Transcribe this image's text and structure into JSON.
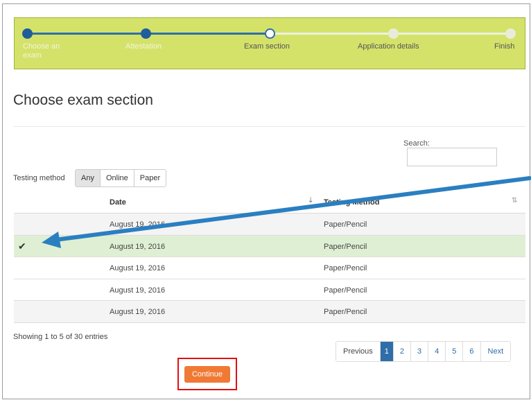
{
  "wizard": {
    "steps": [
      {
        "label": "Choose an exam",
        "state": "done"
      },
      {
        "label": "Attestation",
        "state": "done"
      },
      {
        "label": "Exam section",
        "state": "current"
      },
      {
        "label": "Application details",
        "state": "todo"
      },
      {
        "label": "Finish",
        "state": "todo"
      }
    ]
  },
  "page": {
    "title": "Choose exam section"
  },
  "search": {
    "label": "Search:",
    "value": ""
  },
  "filter": {
    "label": "Testing method",
    "options": [
      "Any",
      "Online",
      "Paper"
    ],
    "selected": "Any"
  },
  "table": {
    "columns": [
      "Date",
      "Testing Method"
    ],
    "rows": [
      {
        "date": "August 19, 2016",
        "method": "Paper/Pencil",
        "selected": false
      },
      {
        "date": "August 19, 2016",
        "method": "Paper/Pencil",
        "selected": true
      },
      {
        "date": "August 19, 2016",
        "method": "Paper/Pencil",
        "selected": false
      },
      {
        "date": "August 19, 2016",
        "method": "Paper/Pencil",
        "selected": false
      },
      {
        "date": "August 19, 2016",
        "method": "Paper/Pencil",
        "selected": false
      }
    ],
    "check_glyph": "✔"
  },
  "info": "Showing 1 to 5 of 30 entries",
  "pagination": {
    "previous": "Previous",
    "pages": [
      "1",
      "2",
      "3",
      "4",
      "5",
      "6"
    ],
    "current": "1",
    "next": "Next"
  },
  "continue_label": "Continue",
  "colors": {
    "wizard_bg": "#d4e26a",
    "accent_blue": "#2f6ea8",
    "button_orange": "#f07a35",
    "highlight_red": "#e01010",
    "selected_row": "#dfefd4"
  }
}
